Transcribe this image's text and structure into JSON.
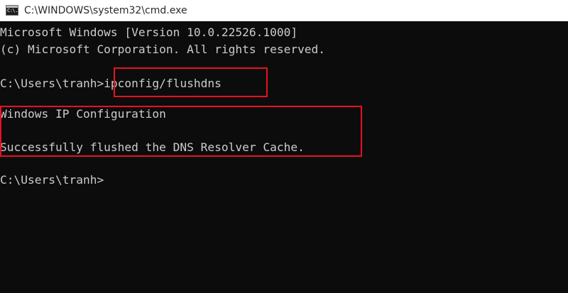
{
  "window": {
    "title": "C:\\WINDOWS\\system32\\cmd.exe",
    "icon": "cmd-icon",
    "icon_glyph": "C:\\.",
    "background": "#0c0c0c",
    "text_color": "#cccccc",
    "highlight_color": "#e81123"
  },
  "console": {
    "version_line": "Microsoft Windows [Version 10.0.22526.1000]",
    "copyright_line": "(c) Microsoft Corporation. All rights reserved.",
    "prompt_1": "C:\\Users\\tranh>",
    "command": "ipconfig/flushdns",
    "output_heading": "Windows IP Configuration",
    "output_result": "Successfully flushed the DNS Resolver Cache.",
    "prompt_2": "C:\\Users\\tranh>"
  }
}
